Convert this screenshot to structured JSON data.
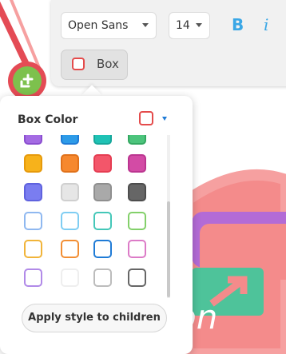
{
  "toolbar": {
    "font_family": "Open Sans",
    "font_size": "14",
    "bold_label": "B",
    "italic_label": "i",
    "box_label": "Box"
  },
  "popup": {
    "title": "Box Color",
    "selected_color": "#e44b4b",
    "apply_label": "Apply style to children"
  },
  "canvas": {
    "visible_text": "on",
    "accent_pink": "#f48b8b",
    "accent_red": "#e44b55",
    "accent_purple": "#b36bd6",
    "accent_green": "#4ec39a"
  },
  "swatches": [
    {
      "row": 0,
      "col": 0,
      "fill": "#a46be3",
      "border": "#8b4fd0"
    },
    {
      "row": 0,
      "col": 1,
      "fill": "#2d9be8",
      "border": "#1f7bd6"
    },
    {
      "row": 0,
      "col": 2,
      "fill": "#1fc2b5",
      "border": "#17a79b"
    },
    {
      "row": 0,
      "col": 3,
      "fill": "#4cc47c",
      "border": "#34a862"
    },
    {
      "row": 1,
      "col": 0,
      "fill": "#f7b21b",
      "border": "#e69a0b"
    },
    {
      "row": 1,
      "col": 1,
      "fill": "#f6882e",
      "border": "#e0711a"
    },
    {
      "row": 1,
      "col": 2,
      "fill": "#f3566a",
      "border": "#e53d52"
    },
    {
      "row": 1,
      "col": 3,
      "fill": "#d34ba5",
      "border": "#bb3590"
    },
    {
      "row": 2,
      "col": 0,
      "fill": "#7a7df0",
      "border": "#5f62de"
    },
    {
      "row": 2,
      "col": 1,
      "fill": "#e6e6e6",
      "border": "#cfcfcf"
    },
    {
      "row": 2,
      "col": 2,
      "fill": "#a9a9a9",
      "border": "#8f8f8f"
    },
    {
      "row": 2,
      "col": 3,
      "fill": "#666666",
      "border": "#4d4d4d"
    },
    {
      "row": 3,
      "col": 0,
      "fill": "#ffffff",
      "border": "#8fb8f0"
    },
    {
      "row": 3,
      "col": 1,
      "fill": "#ffffff",
      "border": "#7fcdf2"
    },
    {
      "row": 3,
      "col": 2,
      "fill": "#ffffff",
      "border": "#44c7b8"
    },
    {
      "row": 3,
      "col": 3,
      "fill": "#ffffff",
      "border": "#83d06a"
    },
    {
      "row": 4,
      "col": 0,
      "fill": "#ffffff",
      "border": "#f1b439"
    },
    {
      "row": 4,
      "col": 1,
      "fill": "#ffffff",
      "border": "#f28e33"
    },
    {
      "row": 4,
      "col": 2,
      "fill": "#ffffff",
      "border": "#1f7bd6"
    },
    {
      "row": 4,
      "col": 3,
      "fill": "#ffffff",
      "border": "#dc7bc7"
    },
    {
      "row": 5,
      "col": 0,
      "fill": "#ffffff",
      "border": "#b18ae8"
    },
    {
      "row": 5,
      "col": 1,
      "fill": "#ffffff",
      "border": "#eeeeee"
    },
    {
      "row": 5,
      "col": 2,
      "fill": "#ffffff",
      "border": "#bcbcbc"
    },
    {
      "row": 5,
      "col": 3,
      "fill": "#ffffff",
      "border": "#666666"
    }
  ]
}
